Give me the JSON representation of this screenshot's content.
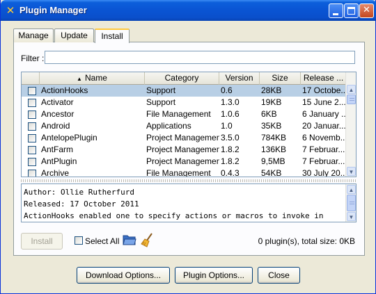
{
  "window": {
    "title": "Plugin Manager"
  },
  "tabs": [
    {
      "label": "Manage"
    },
    {
      "label": "Update"
    },
    {
      "label": "Install"
    }
  ],
  "filter": {
    "label": "Filter :",
    "value": ""
  },
  "table": {
    "columns": [
      "",
      "Name",
      "Category",
      "Version",
      "Size",
      "Release ..."
    ],
    "sort_column": "Name",
    "rows": [
      {
        "name": "ActionHooks",
        "category": "Support",
        "version": "0.6",
        "size": "28KB",
        "release": "17 Octobe...",
        "selected": true
      },
      {
        "name": "Activator",
        "category": "Support",
        "version": "1.3.0",
        "size": "19KB",
        "release": "15 June 2..."
      },
      {
        "name": "Ancestor",
        "category": "File Management",
        "version": "1.0.6",
        "size": "6KB",
        "release": "6 January ..."
      },
      {
        "name": "Android",
        "category": "Applications",
        "version": "1.0",
        "size": "35KB",
        "release": "20 Januar..."
      },
      {
        "name": "AntelopePlugin",
        "category": "Project Management",
        "version": "3.5.0",
        "size": "784KB",
        "release": "6 Novemb..."
      },
      {
        "name": "AntFarm",
        "category": "Project Management",
        "version": "1.8.2",
        "size": "136KB",
        "release": "7 Februar..."
      },
      {
        "name": "AntPlugin",
        "category": "Project Management",
        "version": "1.8.2",
        "size": "9,5MB",
        "release": "7 Februar..."
      },
      {
        "name": "Archive",
        "category": "File Management",
        "version": "0.4.3",
        "size": "54KB",
        "release": "30 July 20..."
      }
    ]
  },
  "description": {
    "lines": [
      "Author: Ollie Rutherfurd",
      "Released: 17 October 2011",
      "ActionHooks enabled one to specify actions or macros to invoke in"
    ]
  },
  "actions": {
    "install_label": "Install",
    "select_all_label": "Select All",
    "status": "0 plugin(s), total size: 0KB"
  },
  "footer": {
    "download_options": "Download Options...",
    "plugin_options": "Plugin Options...",
    "close": "Close"
  }
}
